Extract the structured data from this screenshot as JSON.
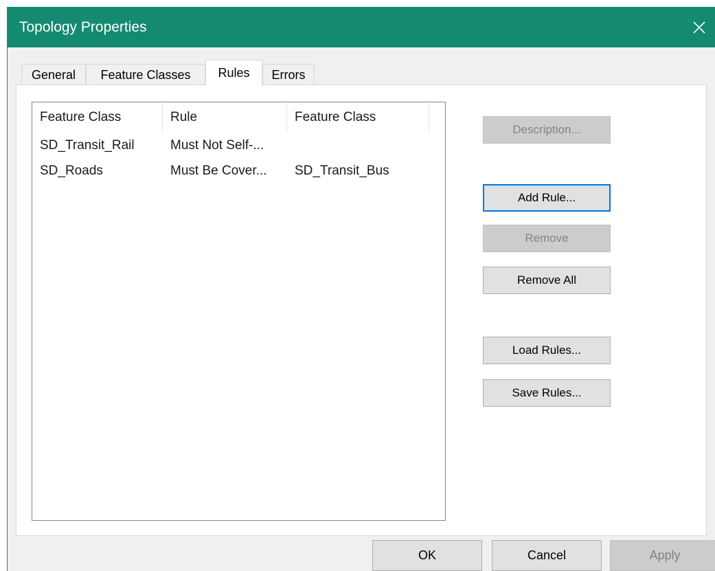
{
  "window": {
    "title": "Topology Properties",
    "titlebar_color": "#148a71"
  },
  "tabs": [
    {
      "label": "General",
      "active": false
    },
    {
      "label": "Feature Classes",
      "active": false
    },
    {
      "label": "Rules",
      "active": true
    },
    {
      "label": "Errors",
      "active": false
    }
  ],
  "rules_list": {
    "columns": [
      "Feature Class",
      "Rule",
      "Feature Class"
    ],
    "rows": [
      [
        "SD_Transit_Rail",
        "Must Not Self-...",
        ""
      ],
      [
        "SD_Roads",
        "Must Be Cover...",
        "SD_Transit_Bus"
      ]
    ]
  },
  "side_buttons": {
    "description": {
      "label": "Description...",
      "enabled": false
    },
    "add_rule": {
      "label": "Add Rule...",
      "enabled": true
    },
    "remove": {
      "label": "Remove",
      "enabled": false
    },
    "remove_all": {
      "label": "Remove All",
      "enabled": true
    },
    "load_rules": {
      "label": "Load Rules...",
      "enabled": true
    },
    "save_rules": {
      "label": "Save Rules...",
      "enabled": true
    }
  },
  "footer": {
    "ok": {
      "label": "OK",
      "enabled": true
    },
    "cancel": {
      "label": "Cancel",
      "enabled": true
    },
    "apply": {
      "label": "Apply",
      "enabled": false
    }
  }
}
